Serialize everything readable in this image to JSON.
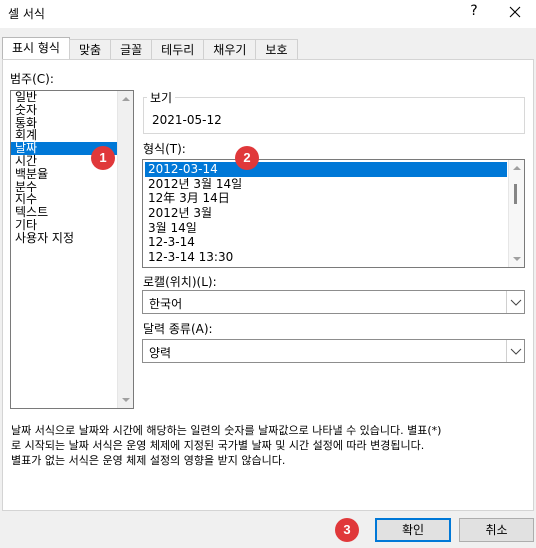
{
  "window": {
    "title": "셀 서식",
    "help_label": "?"
  },
  "tabs": [
    {
      "label": "표시 형식"
    },
    {
      "label": "맞춤"
    },
    {
      "label": "글꼴"
    },
    {
      "label": "테두리"
    },
    {
      "label": "채우기"
    },
    {
      "label": "보호"
    }
  ],
  "category": {
    "label": "범주(C):",
    "items": [
      "일반",
      "숫자",
      "통화",
      "회계",
      "날짜",
      "시간",
      "백분율",
      "분수",
      "지수",
      "텍스트",
      "기타",
      "사용자 지정"
    ],
    "selected": "날짜"
  },
  "preview": {
    "label": "보기",
    "value": "2021-05-12"
  },
  "format": {
    "label": "형식(T):",
    "items": [
      "2012-03-14",
      "2012년 3월 14일",
      "12年 3月 14日",
      "2012년 3월",
      "3월 14일",
      "12-3-14",
      "12-3-14 13:30"
    ],
    "selected": "2012-03-14"
  },
  "locale": {
    "label": "로캘(위치)(L):",
    "value": "한국어"
  },
  "calendar": {
    "label": "달력 종류(A):",
    "value": "양력"
  },
  "description": [
    "날짜 서식으로 날짜와 시간에 해당하는 일련의 숫자를 날짜값으로 나타낼 수 있습니다. 별표(*)",
    "로 시작되는 날짜 서식은 운영 체제에 지정된 국가별 날짜 및 시간 설정에 따라 변경됩니다.",
    "별표가 없는 서식은 운영 체제 설정의 영향을 받지 않습니다."
  ],
  "buttons": {
    "ok": "확인",
    "cancel": "취소"
  },
  "annotations": [
    "1",
    "2",
    "3"
  ],
  "colors": {
    "selection": "#0078d7",
    "badge": "#e0383a"
  }
}
